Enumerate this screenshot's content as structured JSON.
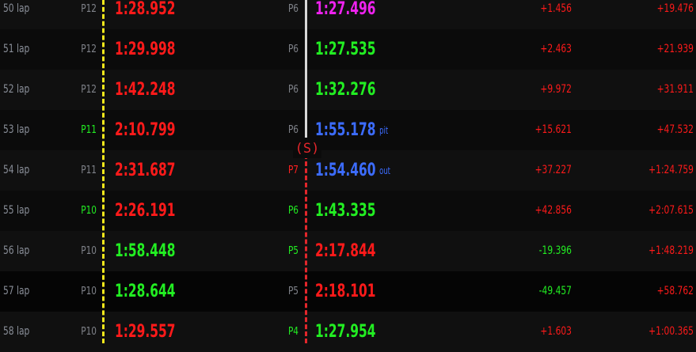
{
  "colors": {
    "red": "#ff1a1a",
    "green": "#22ee22",
    "gray": "#80838a",
    "blue": "#3c6cff",
    "purple": "#ee22ee",
    "yellow_line": "#f5e81c",
    "stop_line": "#e2262b"
  },
  "stop_marker": "(S)",
  "rows": [
    {
      "lap": "50 lap",
      "pos_a": "P12",
      "time_a": "1:28.952",
      "pos_b": "P6",
      "time_b": "1:27.496",
      "tag_b": "",
      "gap_a": "+1.456",
      "gap_b": "+19.476"
    },
    {
      "lap": "51 lap",
      "pos_a": "P12",
      "time_a": "1:29.998",
      "pos_b": "P6",
      "time_b": "1:27.535",
      "tag_b": "",
      "gap_a": "+2.463",
      "gap_b": "+21.939"
    },
    {
      "lap": "52 lap",
      "pos_a": "P12",
      "time_a": "1:42.248",
      "pos_b": "P6",
      "time_b": "1:32.276",
      "tag_b": "",
      "gap_a": "+9.972",
      "gap_b": "+31.911"
    },
    {
      "lap": "53 lap",
      "pos_a": "P11",
      "time_a": "2:10.799",
      "pos_b": "P6",
      "time_b": "1:55.178",
      "tag_b": "pit",
      "gap_a": "+15.621",
      "gap_b": "+47.532"
    },
    {
      "lap": "54 lap",
      "pos_a": "P11",
      "time_a": "2:31.687",
      "pos_b": "P7",
      "time_b": "1:54.460",
      "tag_b": "out",
      "gap_a": "+37.227",
      "gap_b": "+1:24.759"
    },
    {
      "lap": "55 lap",
      "pos_a": "P10",
      "time_a": "2:26.191",
      "pos_b": "P6",
      "time_b": "1:43.335",
      "tag_b": "",
      "gap_a": "+42.856",
      "gap_b": "+2:07.615"
    },
    {
      "lap": "56 lap",
      "pos_a": "P10",
      "time_a": "1:58.448",
      "pos_b": "P5",
      "time_b": "2:17.844",
      "tag_b": "",
      "gap_a": "-19.396",
      "gap_b": "+1:48.219"
    },
    {
      "lap": "57 lap",
      "pos_a": "P10",
      "time_a": "1:28.644",
      "pos_b": "P5",
      "time_b": "2:18.101",
      "tag_b": "",
      "gap_a": "-49.457",
      "gap_b": "+58.762"
    },
    {
      "lap": "58 lap",
      "pos_a": "P10",
      "time_a": "1:29.557",
      "pos_b": "P4",
      "time_b": "1:27.954",
      "tag_b": "",
      "gap_a": "+1.603",
      "gap_b": "+1:00.365"
    }
  ]
}
